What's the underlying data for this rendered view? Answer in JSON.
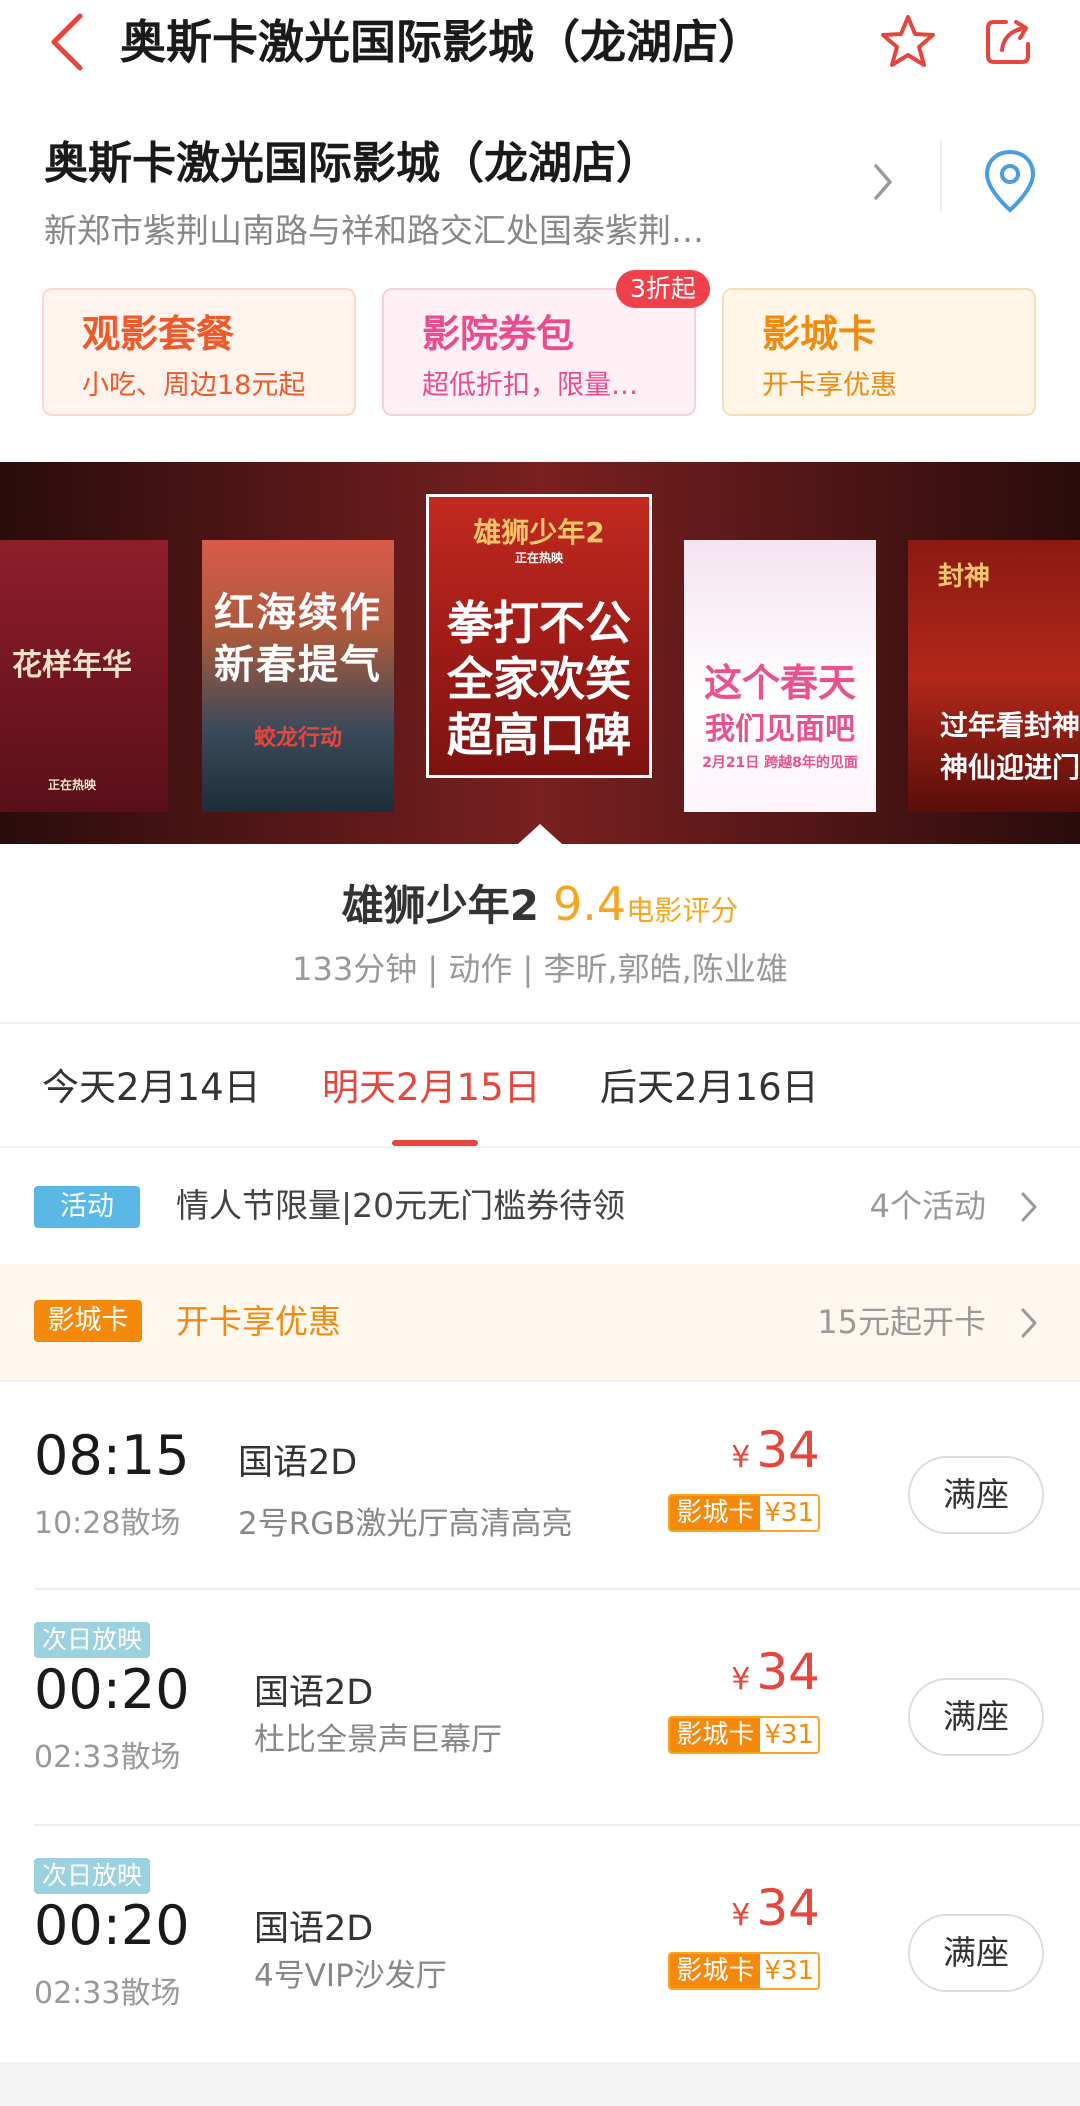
{
  "header": {
    "title": "奥斯卡激光国际影城（龙湖店）"
  },
  "cinema": {
    "name": "奥斯卡激光国际影城（龙湖店）",
    "address": "新郑市紫荆山南路与祥和路交汇处国泰紫荆…"
  },
  "promos": [
    {
      "title": "观影套餐",
      "subtitle": "小吃、周边18元起"
    },
    {
      "title": "影院券包",
      "subtitle": "超低折扣，限量…",
      "badge": "3折起"
    },
    {
      "title": "影城卡",
      "subtitle": "开卡享优惠"
    }
  ],
  "posters": [
    {
      "lines": [
        "花样年华",
        "正在热映"
      ]
    },
    {
      "lines": [
        "红海续作",
        "新春提气",
        "蛟龙行动"
      ]
    },
    {
      "lines": [
        "雄狮少年2",
        "正在热映",
        "拳打不公",
        "全家欢笑",
        "超高口碑"
      ]
    },
    {
      "lines": [
        "这个春天",
        "我们见面吧",
        "2月21日  跨越8年的见面"
      ]
    },
    {
      "lines": [
        "封神",
        "过年看封神",
        "神仙迎进门"
      ]
    }
  ],
  "movie": {
    "title": "雄狮少年2",
    "score": "9.4",
    "score_label": "电影评分",
    "meta": "133分钟 | 动作 | 李昕,郭皓,陈业雄"
  },
  "date_tabs": [
    {
      "label": "今天2月14日",
      "active": false
    },
    {
      "label": "明天2月15日",
      "active": true
    },
    {
      "label": "后天2月16日",
      "active": false
    }
  ],
  "activity": {
    "tag": "活动",
    "text": "情人节限量|20元无门槛券待领",
    "count": "4个活动"
  },
  "card_offer": {
    "tag": "影城卡",
    "text": "开卡享优惠",
    "price": "15元起开卡"
  },
  "showtimes": [
    {
      "next_day": "",
      "start": "08:15",
      "end": "10:28散场",
      "lang": "国语2D",
      "hall": "2号RGB激光厅高清高亮",
      "currency": "¥",
      "price": "34",
      "card_label": "影城卡",
      "card_price": "¥31",
      "button": "满座"
    },
    {
      "next_day": "次日放映",
      "start": "00:20",
      "end": "02:33散场",
      "lang": "国语2D",
      "hall": "杜比全景声巨幕厅",
      "currency": "¥",
      "price": "34",
      "card_label": "影城卡",
      "card_price": "¥31",
      "button": "满座"
    },
    {
      "next_day": "次日放映",
      "start": "00:20",
      "end": "02:33散场",
      "lang": "国语2D",
      "hall": "4号VIP沙发厅",
      "currency": "¥",
      "price": "34",
      "card_label": "影城卡",
      "card_price": "¥31",
      "button": "满座"
    }
  ],
  "colors": {
    "accent": "#e8463c",
    "score": "#f5a623",
    "card_orange": "#f5890c",
    "activity_blue": "#5ab8e6"
  }
}
